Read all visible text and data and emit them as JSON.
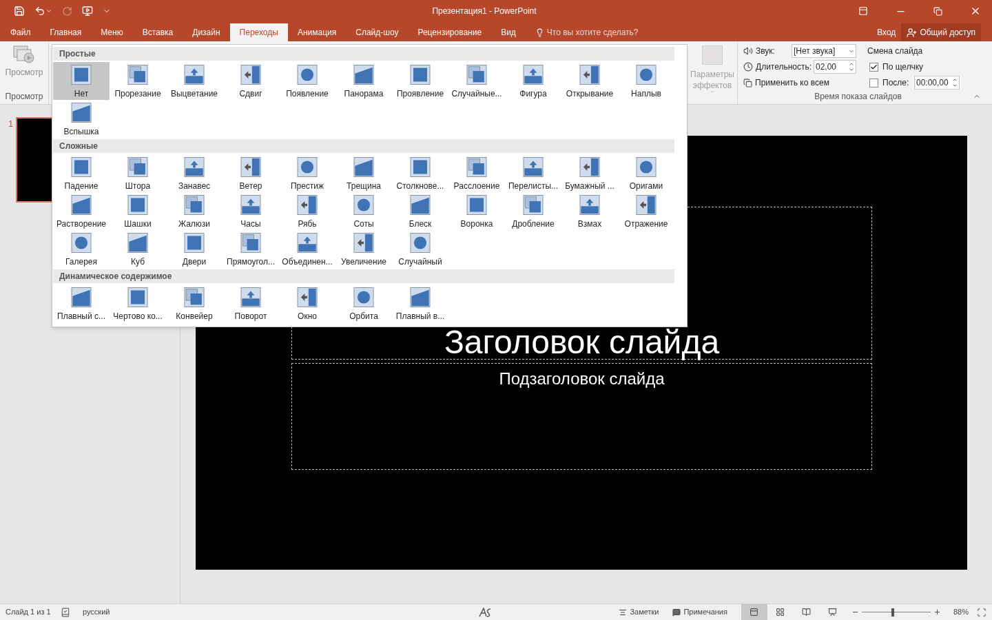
{
  "window": {
    "title": "Презентация1 - PowerPoint"
  },
  "ribbon_tabs": [
    {
      "label": "Файл",
      "selected": false
    },
    {
      "label": "Главная",
      "selected": false
    },
    {
      "label": "Меню",
      "selected": false
    },
    {
      "label": "Вставка",
      "selected": false
    },
    {
      "label": "Дизайн",
      "selected": false
    },
    {
      "label": "Переходы",
      "selected": true
    },
    {
      "label": "Анимация",
      "selected": false
    },
    {
      "label": "Слайд-шоу",
      "selected": false
    },
    {
      "label": "Рецензирование",
      "selected": false
    },
    {
      "label": "Вид",
      "selected": false
    }
  ],
  "tell_me": {
    "placeholder": "Что вы хотите сделать?"
  },
  "account": {
    "sign_in": "Вход",
    "share": "Общий доступ"
  },
  "preview_group": {
    "button": "Просмотр",
    "label": "Просмотр"
  },
  "transition_gallery": {
    "sections": [
      {
        "title": "Простые",
        "items": [
          {
            "label": "Нет",
            "selected": true
          },
          {
            "label": "Прорезание",
            "selected": false
          },
          {
            "label": "Выцветание",
            "selected": false
          },
          {
            "label": "Сдвиг",
            "selected": false
          },
          {
            "label": "Появление",
            "selected": false
          },
          {
            "label": "Панорама",
            "selected": false
          },
          {
            "label": "Проявление",
            "selected": false
          },
          {
            "label": "Случайные...",
            "selected": false
          },
          {
            "label": "Фигура",
            "selected": false
          },
          {
            "label": "Открывание",
            "selected": false
          },
          {
            "label": "Наплыв",
            "selected": false
          },
          {
            "label": "Вспышка",
            "selected": false
          }
        ]
      },
      {
        "title": "Сложные",
        "items": [
          {
            "label": "Падение",
            "selected": false
          },
          {
            "label": "Штора",
            "selected": false
          },
          {
            "label": "Занавес",
            "selected": false
          },
          {
            "label": "Ветер",
            "selected": false
          },
          {
            "label": "Престиж",
            "selected": false
          },
          {
            "label": "Трещина",
            "selected": false
          },
          {
            "label": "Столкнове...",
            "selected": false
          },
          {
            "label": "Расслоение",
            "selected": false
          },
          {
            "label": "Перелисты...",
            "selected": false
          },
          {
            "label": "Бумажный ...",
            "selected": false
          },
          {
            "label": "Оригами",
            "selected": false
          },
          {
            "label": "Растворение",
            "selected": false
          },
          {
            "label": "Шашки",
            "selected": false
          },
          {
            "label": "Жалюзи",
            "selected": false
          },
          {
            "label": "Часы",
            "selected": false
          },
          {
            "label": "Рябь",
            "selected": false
          },
          {
            "label": "Соты",
            "selected": false
          },
          {
            "label": "Блеск",
            "selected": false
          },
          {
            "label": "Воронка",
            "selected": false
          },
          {
            "label": "Дробление",
            "selected": false
          },
          {
            "label": "Взмах",
            "selected": false
          },
          {
            "label": "Отражение",
            "selected": false
          },
          {
            "label": "Галерея",
            "selected": false
          },
          {
            "label": "Куб",
            "selected": false
          },
          {
            "label": "Двери",
            "selected": false
          },
          {
            "label": "Прямоугол...",
            "selected": false
          },
          {
            "label": "Объединен...",
            "selected": false
          },
          {
            "label": "Увеличение",
            "selected": false
          },
          {
            "label": "Случайный",
            "selected": false
          }
        ]
      },
      {
        "title": "Динамическое содержимое",
        "items": [
          {
            "label": "Плавный с...",
            "selected": false
          },
          {
            "label": "Чертово ко...",
            "selected": false
          },
          {
            "label": "Конвейер",
            "selected": false
          },
          {
            "label": "Поворот",
            "selected": false
          },
          {
            "label": "Окно",
            "selected": false
          },
          {
            "label": "Орбита",
            "selected": false
          },
          {
            "label": "Плавный в...",
            "selected": false
          }
        ]
      }
    ]
  },
  "effect_options": {
    "label": "Параметры эффектов",
    "disabled": true
  },
  "timing": {
    "sound_label": "Звук:",
    "sound_value": "[Нет звука]",
    "duration_label": "Длительность:",
    "duration_value": "02,00",
    "apply_all": "Применить ко всем",
    "advance_title": "Смена слайда",
    "on_click": {
      "label": "По щелчку",
      "checked": true
    },
    "after": {
      "label": "После:",
      "checked": false,
      "value": "00:00,00"
    },
    "group_label": "Время показа слайдов"
  },
  "thumbnails": [
    {
      "number": "1",
      "selected": true
    }
  ],
  "slide": {
    "title": "Заголовок слайда",
    "subtitle": "Подзаголовок слайда"
  },
  "status_bar": {
    "slide_info": "Слайд 1 из 1",
    "language": "русский",
    "notes": "Заметки",
    "comments": "Примечания",
    "views": [
      {
        "kind": "normal",
        "selected": true
      },
      {
        "kind": "sorter",
        "selected": false
      },
      {
        "kind": "reading",
        "selected": false
      },
      {
        "kind": "slideshow",
        "selected": false
      }
    ],
    "zoom": {
      "level": 0.43,
      "reading": "88%"
    }
  }
}
